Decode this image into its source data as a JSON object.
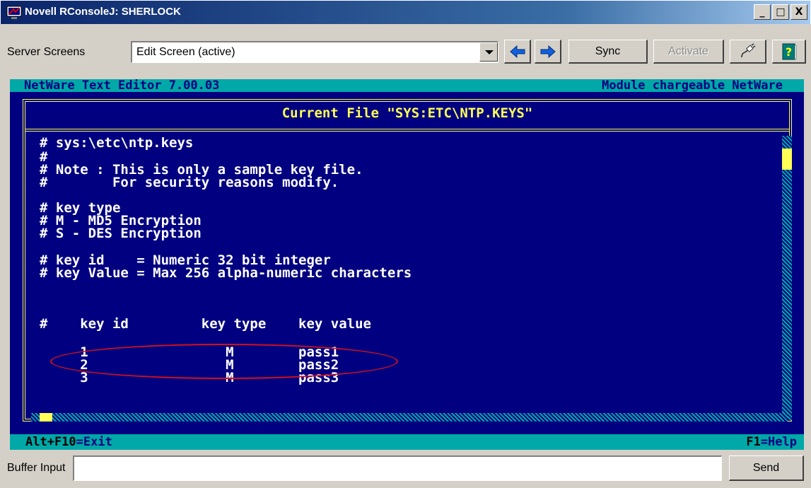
{
  "window": {
    "title": "Novell RConsoleJ: SHERLOCK",
    "min": "_",
    "max": "□",
    "close": "X"
  },
  "toolbar": {
    "server_screens_label": "Server Screens",
    "screen_selected": "Edit Screen (active)",
    "sync_label": "Sync",
    "activate_label": "Activate"
  },
  "console": {
    "header_left": "NetWare Text Editor  7.00.03",
    "header_right": "Module chargeable NetWare",
    "file_title": "Current File \"SYS:ETC\\NTP.KEYS\"",
    "lines": [
      "# sys:\\etc\\ntp.keys",
      "#",
      "# Note : This is only a sample key file.",
      "#        For security reasons modify.",
      "# key type",
      "# M - MD5 Encryption",
      "# S - DES Encryption",
      "# key id    = Numeric 32 bit integer",
      "# key Value = Max 256 alpha-numeric characters",
      "#    key id         key type    key value",
      "     1                 M        pass1",
      "     2                 M        pass2",
      "     3                 M        pass3"
    ],
    "footer_left_key": "Alt+F10",
    "footer_left_val": "=Exit",
    "footer_right_key": "F1",
    "footer_right_val": "=Help"
  },
  "bottom": {
    "buffer_input_label": "Buffer Input",
    "buffer_input_value": "",
    "send_label": "Send"
  },
  "colors": {
    "console_bg": "#000080",
    "console_accent": "#00a8a8",
    "frame": "#ffff55",
    "highlight_oval": "#d4101a"
  }
}
